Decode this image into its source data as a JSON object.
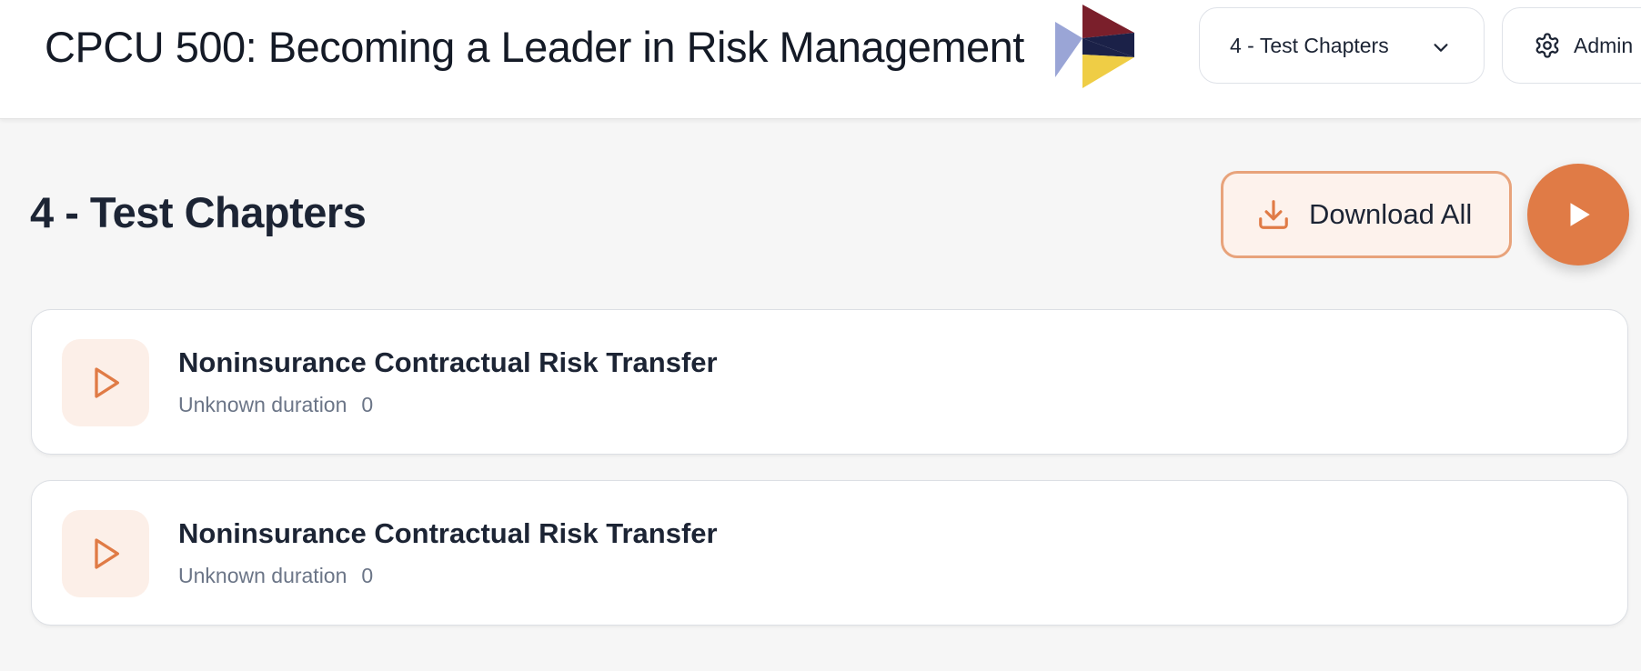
{
  "header": {
    "course_title": "CPCU 500: Becoming a Leader in Risk Management",
    "chapter_select": {
      "selected": "4 - Test Chapters"
    },
    "admin_label": "Admin"
  },
  "main": {
    "section_title": "4 - Test Chapters",
    "download_all_label": "Download All",
    "lessons": [
      {
        "title": "Noninsurance Contractual Risk Transfer",
        "duration": "Unknown duration",
        "count": "0"
      },
      {
        "title": "Noninsurance Contractual Risk Transfer",
        "duration": "Unknown duration",
        "count": "0"
      }
    ]
  },
  "colors": {
    "accent": "#e07b46",
    "accent_light": "#fcefe8",
    "text_dark": "#1c2434",
    "text_muted": "#6b7587",
    "logo_red": "#7a1f2b",
    "logo_navy": "#1b2148",
    "logo_blue": "#9aa5d6",
    "logo_yellow": "#efcd45"
  }
}
